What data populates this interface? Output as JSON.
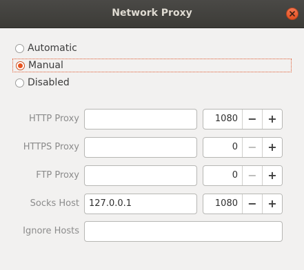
{
  "window": {
    "title": "Network Proxy"
  },
  "titlebar": {
    "close_icon": "close-icon",
    "close_color": "#e95420"
  },
  "mode": {
    "options": [
      {
        "label": "Automatic",
        "checked": false
      },
      {
        "label": "Manual",
        "checked": true
      },
      {
        "label": "Disabled",
        "checked": false
      }
    ],
    "accent": "#e95420"
  },
  "proxies": {
    "http": {
      "label": "HTTP Proxy",
      "host": "",
      "port": "1080",
      "minus_enabled": true,
      "minus": "−",
      "plus": "+"
    },
    "https": {
      "label": "HTTPS Proxy",
      "host": "",
      "port": "0",
      "minus_enabled": false,
      "minus": "−",
      "plus": "+"
    },
    "ftp": {
      "label": "FTP Proxy",
      "host": "",
      "port": "0",
      "minus_enabled": false,
      "minus": "−",
      "plus": "+"
    },
    "socks": {
      "label": "Socks Host",
      "host": "127.0.0.1",
      "port": "1080",
      "minus_enabled": true,
      "minus": "−",
      "plus": "+"
    },
    "ignore": {
      "label": "Ignore Hosts",
      "value": ""
    }
  }
}
